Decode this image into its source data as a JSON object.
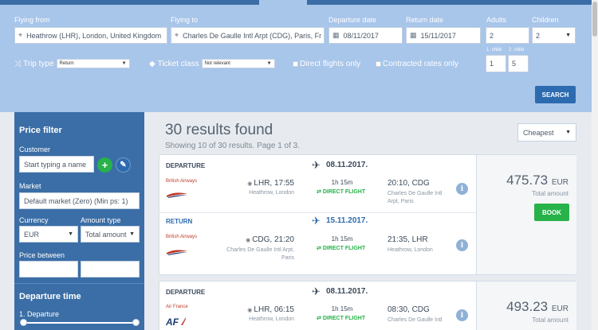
{
  "search": {
    "flying_from_label": "Flying from",
    "flying_from_value": "Heathrow (LHR), London, United Kingdom",
    "flying_to_label": "Flying to",
    "flying_to_value": "Charles De Gaulle Intl Arpt (CDG), Paris, Fr",
    "departure_label": "Departure date",
    "departure_value": "08/11/2017",
    "return_label": "Return date",
    "return_value": "15/11/2017",
    "adults_label": "Adults",
    "adults_value": "2",
    "children_label": "Children",
    "children_value": "2",
    "trip_type_label": "Trip type",
    "trip_type_value": "Return",
    "ticket_class_label": "Ticket class",
    "ticket_class_value": "Not relevant",
    "direct_label": "Direct flights only",
    "contracted_label": "Contracted rates only",
    "child1_label": "1. child",
    "child1_value": "1",
    "child2_label": "2. child",
    "child2_value": "5",
    "search_button": "SEARCH"
  },
  "filter": {
    "heading": "Price filter",
    "customer_label": "Customer",
    "customer_placeholder": "Start typing a name",
    "market_label": "Market",
    "market_value": "Default market (Zero) (Min ps: 1)",
    "currency_label": "Currency",
    "currency_value": "EUR",
    "amount_type_label": "Amount type",
    "amount_type_value": "Total amount",
    "price_between_label": "Price between",
    "departure_time_heading": "Departure time",
    "departure_slider_label": "1. Departure"
  },
  "results": {
    "title": "30 results found",
    "subtitle": "Showing 10 of 30 results. Page 1 of 3.",
    "sort_value": "Cheapest",
    "cards": [
      {
        "segments": [
          {
            "label": "DEPARTURE",
            "date": "08.11.2017.",
            "airline": "British Airways",
            "dep_time": "LHR, 17:55",
            "dep_place": "Heathrow, London",
            "duration": "1h 15m",
            "direct": "DIRECT FLIGHT",
            "arr_time": "20:10, CDG",
            "arr_place": "Charles De Gaulle Intl Arpt, Paris"
          },
          {
            "label": "RETURN",
            "date": "15.11.2017.",
            "airline": "British Airways",
            "dep_time": "CDG, 21:20",
            "dep_place": "Charles De Gaulle Intl Arpt, Paris",
            "duration": "1h 15m",
            "direct": "DIRECT FLIGHT",
            "arr_time": "21:35, LHR",
            "arr_place": "Heathrow, London"
          }
        ],
        "price": "475.73",
        "currency": "EUR",
        "total_label": "Total amount",
        "book_label": "BOOK"
      },
      {
        "segments": [
          {
            "label": "DEPARTURE",
            "date": "08.11.2017.",
            "airline": "Air France",
            "dep_time": "LHR, 06:15",
            "dep_place": "Heathrow, London",
            "duration": "1h 15m",
            "direct": "DIRECT FLIGHT",
            "arr_time": "08:30, CDG",
            "arr_place": "Charles De Gaulle Intl"
          }
        ],
        "price": "493.23",
        "currency": "EUR",
        "total_label": "Total amount"
      }
    ]
  },
  "icons": {
    "plane": "✈",
    "info": "i",
    "add": "+",
    "edit": "✎",
    "calendar": "▦",
    "location": "⌖"
  },
  "colors": {
    "header_blue": "#a8c5ea",
    "sidebar_blue": "#3b6ea6",
    "accent_blue": "#2d6bb0",
    "green": "#27b24a",
    "background": "#e7ebf0"
  }
}
